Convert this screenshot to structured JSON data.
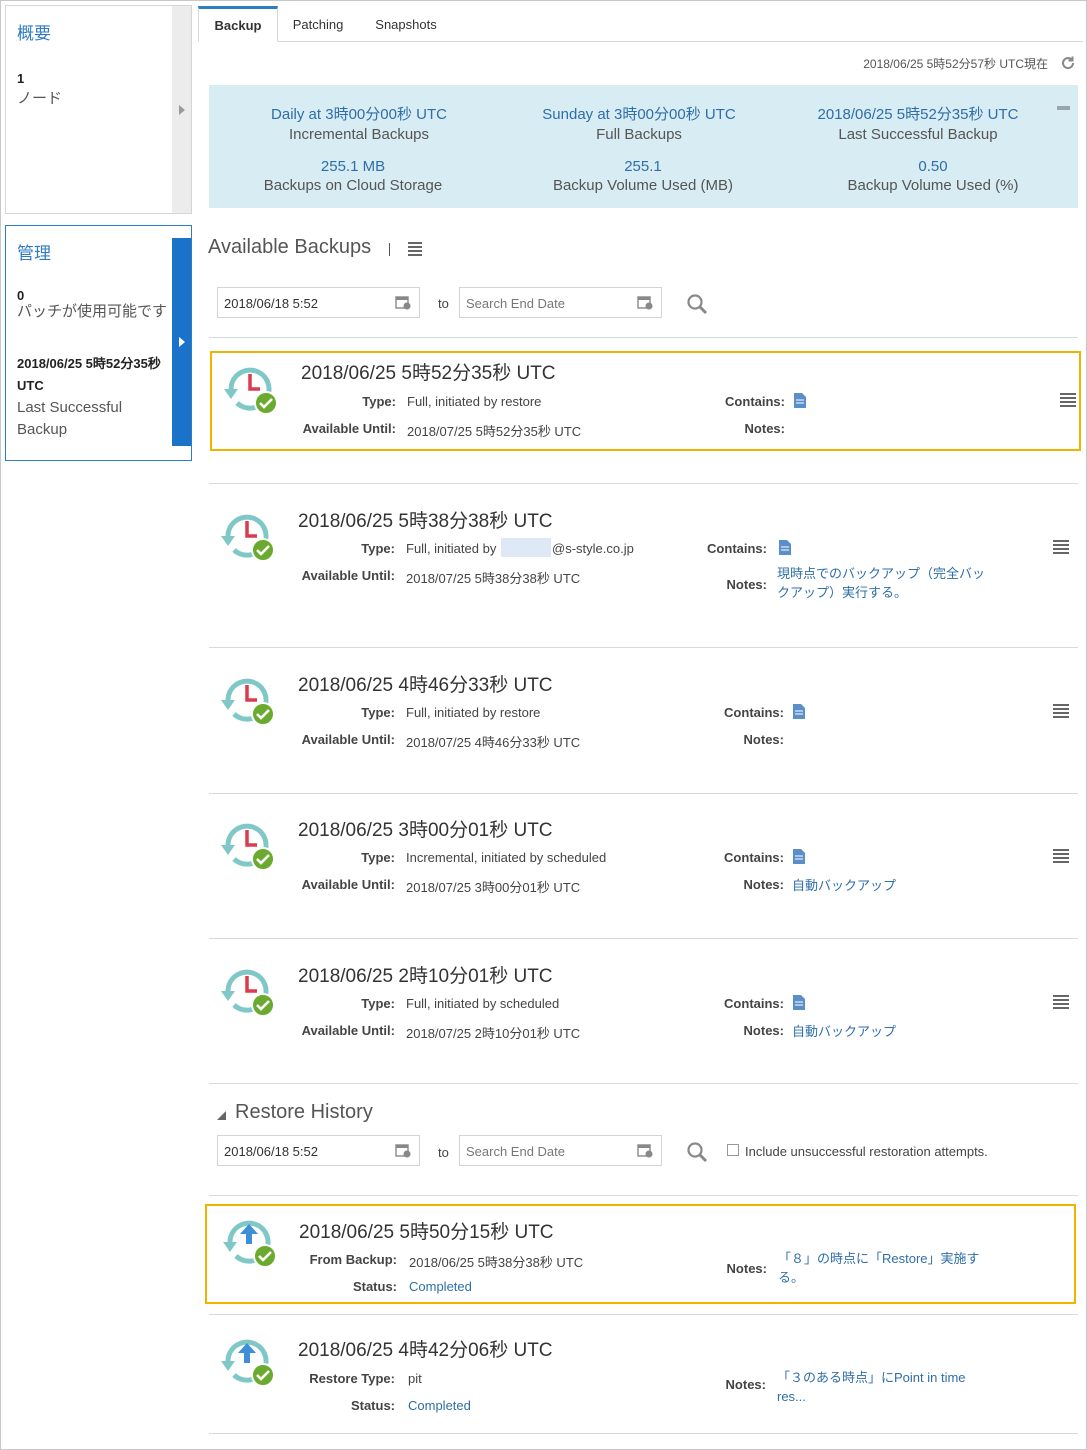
{
  "sidebar": {
    "overview": {
      "title": "概要",
      "count": "1",
      "label": "ノード"
    },
    "manage": {
      "title": "管理",
      "count": "0",
      "label": "パッチが使用可能です",
      "last_backup_time": "2018/06/25 5時52分35秒 UTC",
      "last_backup_label": "Last Successful Backup"
    }
  },
  "tabs": [
    "Backup",
    "Patching",
    "Snapshots"
  ],
  "as_of": "2018/06/25 5時52分57秒 UTC現在",
  "summary": {
    "incremental": {
      "value": "Daily at 3時00分00秒 UTC",
      "label": "Incremental Backups"
    },
    "full": {
      "value": "Sunday at 3時00分00秒 UTC",
      "label": "Full Backups"
    },
    "last": {
      "value": "2018/06/25 5時52分35秒 UTC",
      "label": "Last Successful Backup"
    },
    "cloud": {
      "value": "255.1 MB",
      "label": "Backups on Cloud Storage"
    },
    "volume_mb": {
      "value": "255.1",
      "label": "Backup Volume Used (MB)"
    },
    "volume_pct": {
      "value": "0.50",
      "label": "Backup Volume Used (%)"
    }
  },
  "available_backups": {
    "title": "Available Backups",
    "start_date": "2018/06/18 5:52",
    "end_placeholder": "Search End Date",
    "to_label": "to",
    "items": [
      {
        "title": "2018/06/25 5時52分35秒 UTC",
        "type_label": "Type:",
        "type": "Full, initiated by restore",
        "until_label": "Available Until:",
        "until": "2018/07/25 5時52分35秒 UTC",
        "contains_label": "Contains:",
        "notes_label": "Notes:",
        "notes": ""
      },
      {
        "title": "2018/06/25 5時38分38秒 UTC",
        "type_label": "Type:",
        "type": "Full, initiated by",
        "type_suffix": "@s-style.co.jp",
        "until_label": "Available Until:",
        "until": "2018/07/25 5時38分38秒 UTC",
        "contains_label": "Contains:",
        "notes_label": "Notes:",
        "notes_line1": "現時点でのバックアップ（完全バッ",
        "notes_line2": "クアップ）実行する。"
      },
      {
        "title": "2018/06/25 4時46分33秒 UTC",
        "type_label": "Type:",
        "type": "Full, initiated by restore",
        "until_label": "Available Until:",
        "until": "2018/07/25 4時46分33秒 UTC",
        "contains_label": "Contains:",
        "notes_label": "Notes:",
        "notes": ""
      },
      {
        "title": "2018/06/25 3時00分01秒 UTC",
        "type_label": "Type:",
        "type": "Incremental, initiated by scheduled",
        "until_label": "Available Until:",
        "until": "2018/07/25 3時00分01秒 UTC",
        "contains_label": "Contains:",
        "notes_label": "Notes:",
        "notes": "自動バックアップ"
      },
      {
        "title": "2018/06/25 2時10分01秒 UTC",
        "type_label": "Type:",
        "type": "Full, initiated by scheduled",
        "until_label": "Available Until:",
        "until": "2018/07/25 2時10分01秒 UTC",
        "contains_label": "Contains:",
        "notes_label": "Notes:",
        "notes": "自動バックアップ"
      }
    ]
  },
  "restore_history": {
    "title": "Restore History",
    "start_date": "2018/06/18 5:52",
    "end_placeholder": "Search End Date",
    "to_label": "to",
    "include_label": "Include unsuccessful restoration attempts.",
    "items": [
      {
        "title": "2018/06/25 5時50分15秒 UTC",
        "field1_label": "From Backup:",
        "field1": "2018/06/25 5時38分38秒 UTC",
        "status_label": "Status:",
        "status": "Completed",
        "notes_label": "Notes:",
        "notes_line1": "「８」の時点に「Restore」実施す",
        "notes_line2": "る。"
      },
      {
        "title": "2018/06/25 4時42分06秒 UTC",
        "field1_label": "Restore Type:",
        "field1": "pit",
        "status_label": "Status:",
        "status": "Completed",
        "notes_label": "Notes:",
        "notes_line1": "「３のある時点」にPoint in time",
        "notes_line2": "res..."
      }
    ]
  },
  "colors": {
    "accent": "#2d7fc1",
    "link": "#2e6ea9",
    "selected_border": "#f0b400",
    "summary_bg": "#d8ecf3",
    "success": "#6aab2f"
  }
}
